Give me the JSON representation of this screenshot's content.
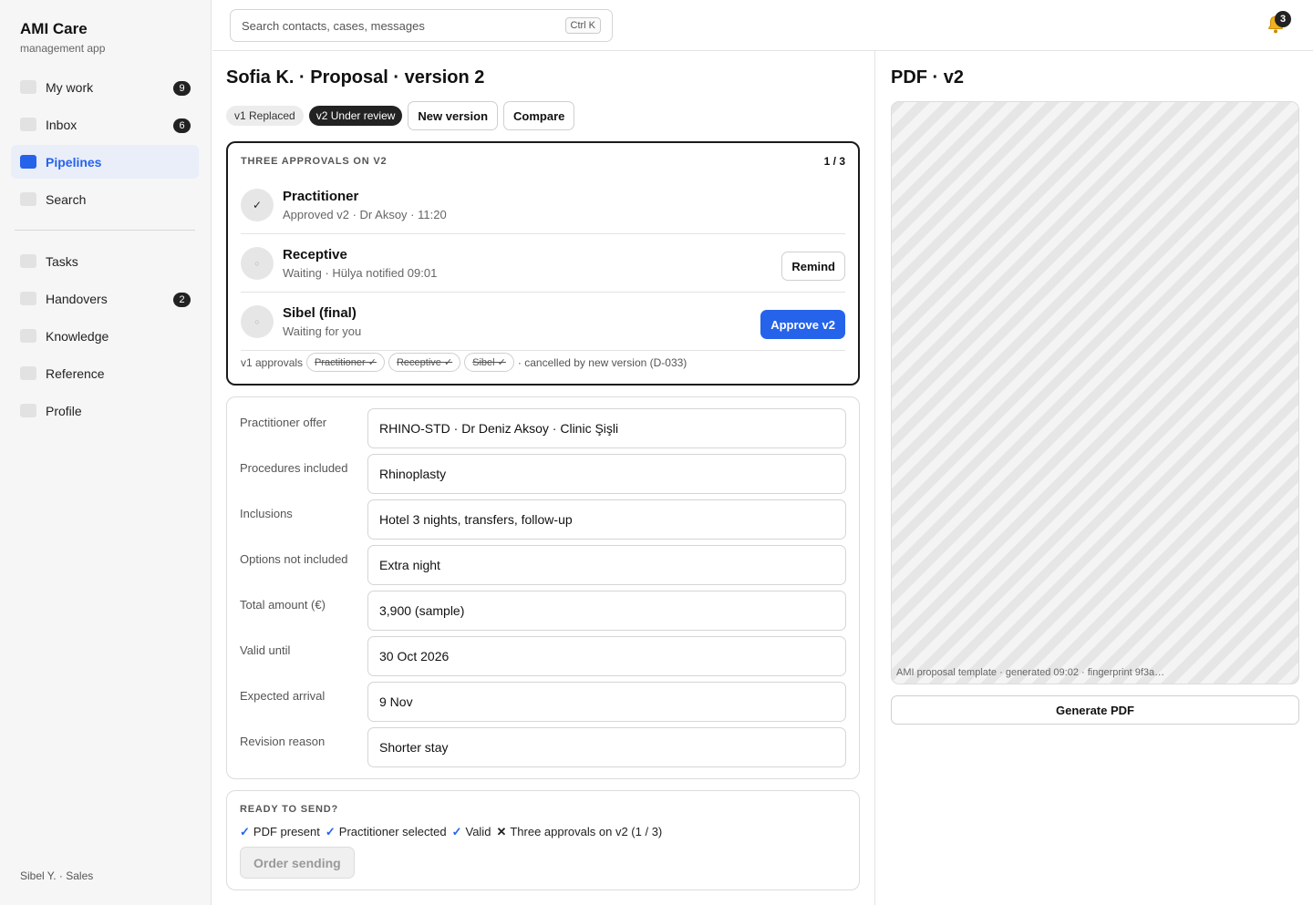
{
  "app": {
    "title": "AMI Care",
    "subtitle": "management app"
  },
  "sidebar": {
    "primary": [
      {
        "label": "My work",
        "count": "9"
      },
      {
        "label": "Inbox",
        "count": "6"
      },
      {
        "label": "Pipelines",
        "active": true
      },
      {
        "label": "Search"
      }
    ],
    "secondary": [
      {
        "label": "Tasks"
      },
      {
        "label": "Handovers",
        "count": "2"
      },
      {
        "label": "Knowledge"
      },
      {
        "label": "Reference"
      },
      {
        "label": "Profile"
      }
    ],
    "footer": "Sibel Y. · Sales"
  },
  "topbar": {
    "search_placeholder": "Search contacts, cases, messages",
    "shortcut": "Ctrl K",
    "notifications_count": "3"
  },
  "proposal": {
    "title": "Sofia K. · Proposal · version 2",
    "chips": {
      "v1": "v1 Replaced",
      "v2": "v2 Under review"
    },
    "new_version_label": "New version",
    "compare_label": "Compare"
  },
  "approvals": {
    "heading": "THREE APPROVALS ON V2",
    "count": "1 / 3",
    "rows": [
      {
        "name": "Practitioner",
        "status": "Approved v2 · Dr Aksoy · 11:20",
        "icon": "✓"
      },
      {
        "name": "Receptive",
        "status": "Waiting · Hülya notified 09:01",
        "icon": "○",
        "action": "Remind"
      },
      {
        "name": "Sibel (final)",
        "status": "Waiting for you",
        "icon": "○",
        "action": "Approve v2"
      }
    ],
    "v1": {
      "label": "v1 approvals",
      "chips": [
        "Practitioner ✓",
        "Receptive ✓",
        "Sibel ✓"
      ],
      "note": "· cancelled by new version (D-033)"
    }
  },
  "form": {
    "fields": [
      {
        "label": "Practitioner offer",
        "value": "RHINO-STD · Dr Deniz Aksoy · Clinic Şişli"
      },
      {
        "label": "Procedures included",
        "value": "Rhinoplasty"
      },
      {
        "label": "Inclusions",
        "value": "Hotel 3 nights, transfers, follow-up"
      },
      {
        "label": "Options not included",
        "value": "Extra night"
      },
      {
        "label": "Total amount (€)",
        "value": "3,900 (sample)"
      },
      {
        "label": "Valid until",
        "value": "30 Oct 2026"
      },
      {
        "label": "Expected arrival",
        "value": "9 Nov"
      },
      {
        "label": "Revision reason",
        "value": "Shorter stay"
      }
    ]
  },
  "send": {
    "heading": "READY TO SEND?",
    "checks": [
      {
        "mark": "✓",
        "text": "PDF present",
        "ok": true
      },
      {
        "mark": "✓",
        "text": "Practitioner selected",
        "ok": true
      },
      {
        "mark": "✓",
        "text": "Valid",
        "ok": true
      },
      {
        "mark": "✕",
        "text": "Three approvals on v2 (1 / 3)",
        "ok": false
      }
    ],
    "button": "Order sending"
  },
  "pdf": {
    "title": "PDF · v2",
    "caption": "AMI proposal template · generated 09:02 · fingerprint 9f3a…",
    "generate_label": "Generate PDF"
  },
  "colors": {
    "accent": "#2563eb",
    "dark": "#222222"
  }
}
